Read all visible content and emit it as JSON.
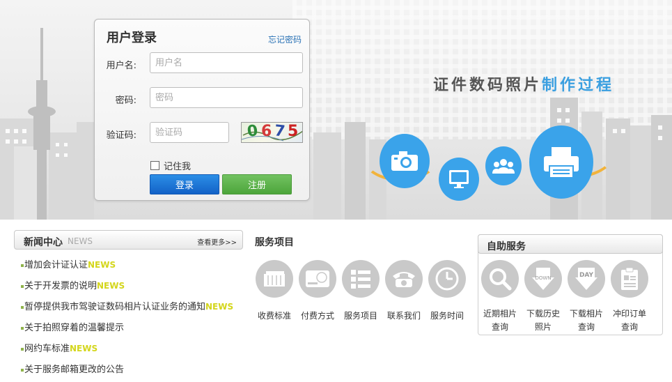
{
  "login": {
    "title": "用户登录",
    "forgot_link": "忘记密码",
    "username_label": "用户名:",
    "username_placeholder": "用户名",
    "password_label": "密码:",
    "password_placeholder": "密码",
    "captcha_label": "验证码:",
    "captcha_placeholder": "验证码",
    "captcha_text": [
      "0",
      "6",
      "7",
      "5"
    ],
    "remember_label": "记住我",
    "login_button": "登录",
    "register_button": "注册"
  },
  "banner": {
    "title_part1": "证件数码照片",
    "title_part2": "制作过程"
  },
  "news": {
    "title": "新闻中心",
    "title_en": "NEWS",
    "more": "查看更多>>",
    "items": [
      {
        "text": "增加会计证认证",
        "tag": "NEWS"
      },
      {
        "text": "关于开发票的说明",
        "tag": "NEWS"
      },
      {
        "text": "暂停提供我市驾驶证数码相片认证业务的通知",
        "tag": "NEWS"
      },
      {
        "text": "关于拍照穿着的温馨提示",
        "tag": ""
      },
      {
        "text": "网约车标准",
        "tag": "NEWS"
      },
      {
        "text": "关于服务邮箱更改的公告",
        "tag": ""
      }
    ]
  },
  "services": {
    "title": "服务项目",
    "items": [
      {
        "label": "收费标准",
        "icon": "price-standard-icon"
      },
      {
        "label": "付费方式",
        "icon": "payment-card-icon"
      },
      {
        "label": "服务项目",
        "icon": "service-list-icon"
      },
      {
        "label": "联系我们",
        "icon": "phone-icon"
      },
      {
        "label": "服务时间",
        "icon": "clock-icon"
      }
    ]
  },
  "self_service": {
    "title": "自助服务",
    "items": [
      {
        "line1": "近期相片",
        "line2": "查询",
        "icon": "search-icon"
      },
      {
        "line1": "下载历史",
        "line2": "照片",
        "icon": "download-icon",
        "icon_text": "DOWN"
      },
      {
        "line1": "下载相片",
        "line2": "查询",
        "icon": "day-download-icon",
        "icon_text": "DAY"
      },
      {
        "line1": "冲印订单",
        "line2": "查询",
        "icon": "order-doc-icon"
      }
    ]
  },
  "colors": {
    "accent_blue": "#3aa3ea",
    "login_button": "#1c6fd1",
    "register_button": "#5cb349",
    "news_tag": "#d4d61c",
    "icon_gray": "#c9c9c9"
  }
}
